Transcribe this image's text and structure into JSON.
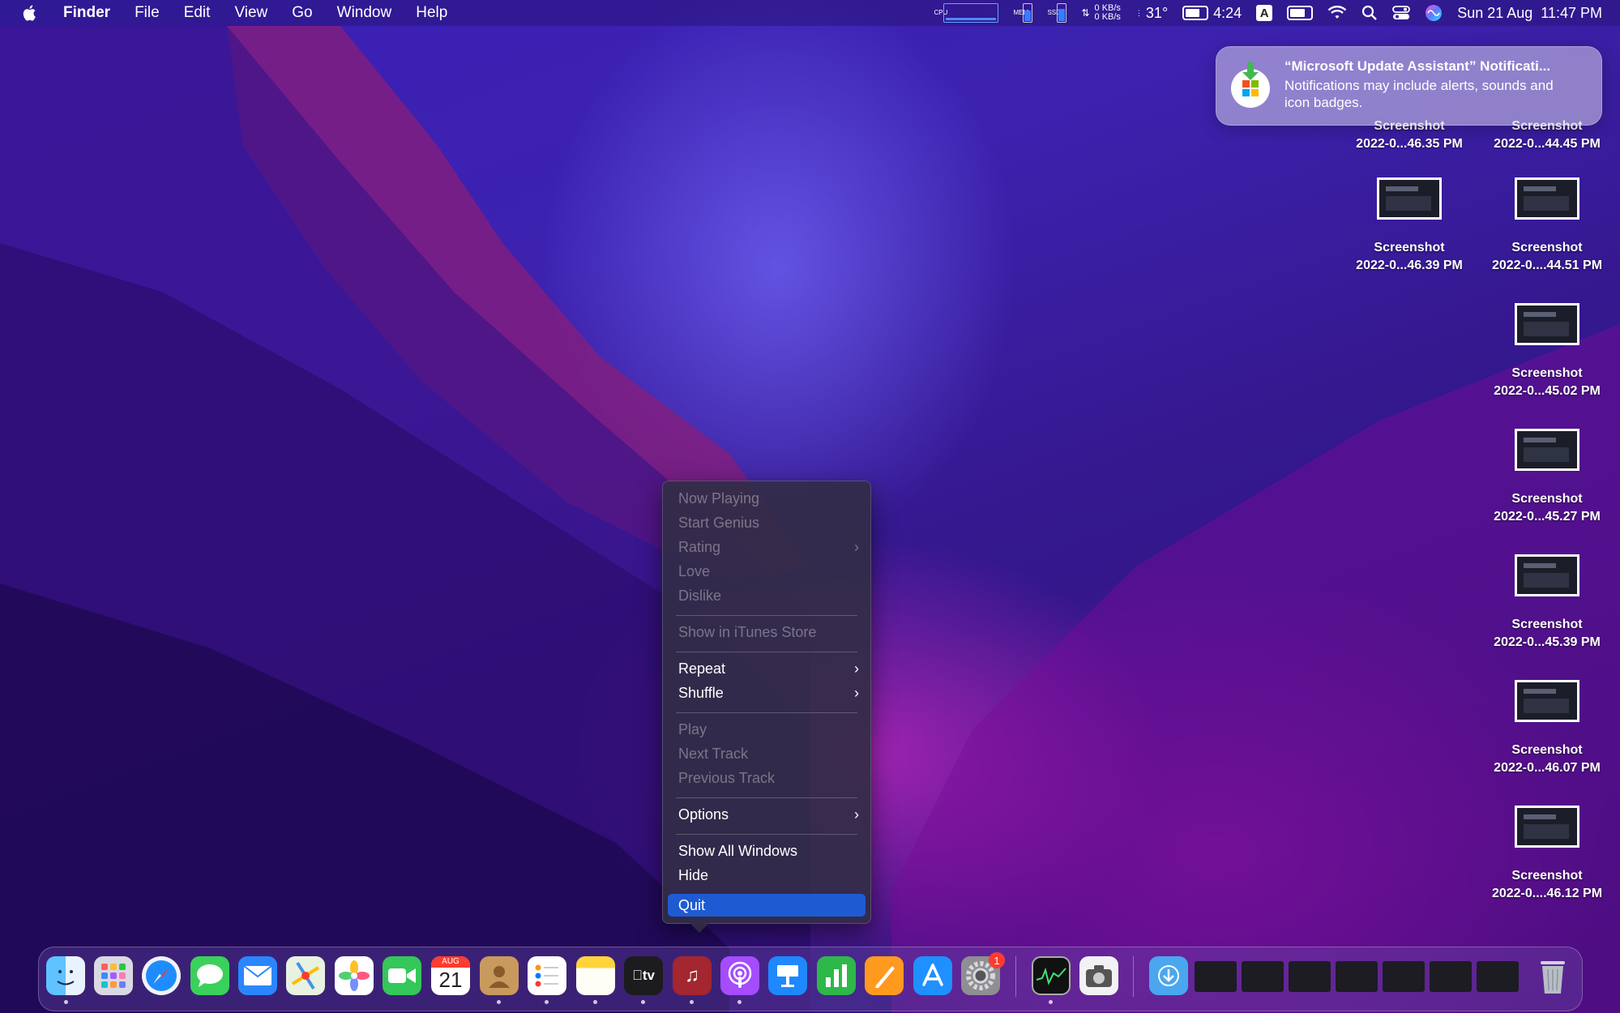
{
  "menubar": {
    "app_name": "Finder",
    "menus": [
      "File",
      "Edit",
      "View",
      "Go",
      "Window",
      "Help"
    ],
    "cpu_label": "CPU",
    "mem_label": "MEM",
    "ssd_label": "SSD",
    "net_up": "0 KB/s",
    "net_down": "0 KB/s",
    "temp": "31°",
    "battery_time": "4:24",
    "input_source": "A",
    "datetime": "Sun 21 Aug  11:47 PM"
  },
  "notification": {
    "title": "“Microsoft Update Assistant” Notificati...",
    "body": "Notifications may include alerts, sounds and icon badges."
  },
  "desktop_icons": [
    {
      "line1": "Screenshot",
      "line2": "2022-0...46.35 PM",
      "partial": true
    },
    {
      "line1": "Screenshot",
      "line2": "2022-0...44.45 PM",
      "partial": true
    },
    {
      "line1": "Screenshot",
      "line2": "2022-0...46.39 PM"
    },
    {
      "line1": "Screenshot",
      "line2": "2022-0....44.51 PM"
    },
    {
      "line1": "Screenshot",
      "line2": "2022-0...45.02 PM"
    },
    {
      "line1": "Screenshot",
      "line2": "2022-0...45.27 PM"
    },
    {
      "line1": "Screenshot",
      "line2": "2022-0...45.39 PM"
    },
    {
      "line1": "Screenshot",
      "line2": "2022-0...46.07 PM"
    },
    {
      "line1": "Screenshot",
      "line2": "2022-0....46.12 PM"
    }
  ],
  "context_menu": {
    "items": [
      {
        "label": "Now Playing",
        "enabled": false
      },
      {
        "label": "Start Genius",
        "enabled": false
      },
      {
        "label": "Rating",
        "enabled": false,
        "submenu": true
      },
      {
        "label": "Love",
        "enabled": false
      },
      {
        "label": "Dislike",
        "enabled": false
      },
      {
        "label": "Show in iTunes Store",
        "enabled": false
      },
      {
        "label": "Repeat",
        "enabled": true,
        "submenu": true
      },
      {
        "label": "Shuffle",
        "enabled": true,
        "submenu": true
      },
      {
        "label": "Play",
        "enabled": false
      },
      {
        "label": "Next Track",
        "enabled": false
      },
      {
        "label": "Previous Track",
        "enabled": false
      },
      {
        "label": "Options",
        "enabled": true,
        "submenu": true
      },
      {
        "label": "Show All Windows",
        "enabled": true
      },
      {
        "label": "Hide",
        "enabled": true
      },
      {
        "label": "Quit",
        "enabled": true,
        "selected": true
      }
    ],
    "chevron": "›"
  },
  "dock": {
    "apps": [
      "Finder",
      "Launchpad",
      "Safari",
      "Messages",
      "Mail",
      "Maps",
      "Photos",
      "FaceTime",
      "Calendar",
      "Contacts",
      "Reminders",
      "Notes",
      "TV",
      "Music",
      "Podcasts",
      "Keynote",
      "Numbers",
      "Pages",
      "App Store",
      "System Preferences",
      "Activity Monitor",
      "Screenshot",
      "Downloads",
      "Trash"
    ],
    "calendar_month": "AUG",
    "calendar_day": "21",
    "tv_label": "tv",
    "settings_badge": "1"
  }
}
